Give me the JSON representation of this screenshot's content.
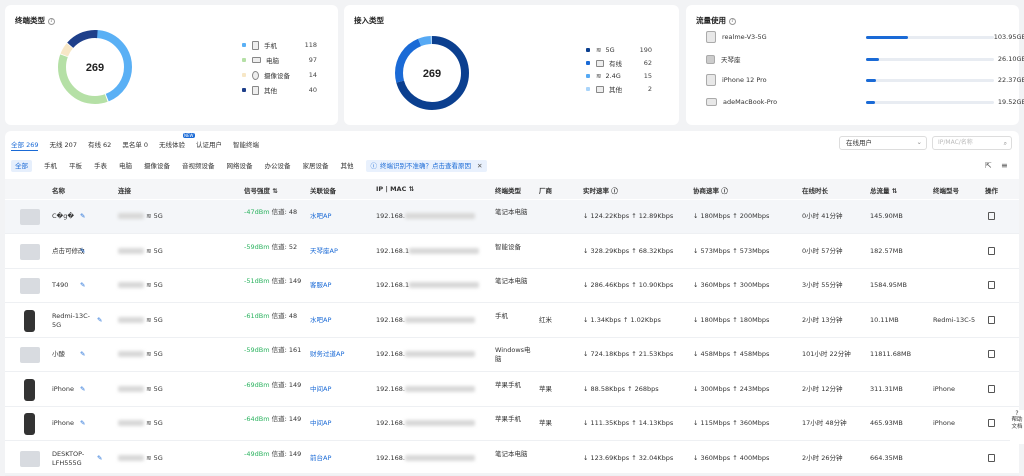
{
  "terminal_type": {
    "title": "终端类型",
    "total": "269",
    "items": [
      {
        "label": "手机",
        "value": "118",
        "color": "#5ab0f5"
      },
      {
        "label": "电脑",
        "value": "97",
        "color": "#b5e0a6"
      },
      {
        "label": "摄像设备",
        "value": "14",
        "color": "#f7e7c6"
      },
      {
        "label": "其他",
        "value": "40",
        "color": "#1e3f8a"
      }
    ]
  },
  "access_type": {
    "title": "接入类型",
    "total": "269",
    "items": [
      {
        "label": "5G",
        "value": "190",
        "color": "#0b3f8f"
      },
      {
        "label": "有线",
        "value": "62",
        "color": "#1a6ad6"
      },
      {
        "label": "2.4G",
        "value": "15",
        "color": "#56a9f4"
      },
      {
        "label": "其他",
        "value": "2",
        "color": "#a9d4fa"
      }
    ]
  },
  "traffic": {
    "title": "流量使用",
    "items": [
      {
        "label": "realme-V3-5G",
        "value": "103.95GB",
        "ratio": 0.33
      },
      {
        "label": "天琴座",
        "value": "26.10GB",
        "ratio": 0.1
      },
      {
        "label": "iPhone 12 Pro",
        "value": "22.37GB",
        "ratio": 0.08
      },
      {
        "label": "adeMacBook-Pro",
        "value": "19.52GB",
        "ratio": 0.07
      }
    ]
  },
  "tabs": [
    {
      "label": "全部 269",
      "active": true
    },
    {
      "label": "无线 207"
    },
    {
      "label": "有线 62"
    },
    {
      "label": "黑名单 0"
    },
    {
      "label": "无线体验",
      "badge": "NEW"
    },
    {
      "label": "认证用户"
    },
    {
      "label": "智能终端"
    }
  ],
  "filter": {
    "select": "在线用户",
    "search_placeholder": "IP/MAC/名称"
  },
  "chips": [
    "全部",
    "手机",
    "平板",
    "手表",
    "电脑",
    "摄像设备",
    "音视频设备",
    "网络设备",
    "办公设备",
    "家居设备",
    "其他"
  ],
  "notice": "终端识别不准确？点击查看原因",
  "columns": [
    "名称",
    "连接",
    "信号强度",
    "关联设备",
    "IP | MAC",
    "终端类型",
    "厂商",
    "实时速率",
    "协商速率",
    "在线时长",
    "总流量",
    "终端型号",
    "操作"
  ],
  "rows": [
    {
      "name": "C�g�",
      "band": "5G",
      "signal": "-47dBm",
      "channel": "信道: 48",
      "ap": "水吧AP",
      "ip": "192.168.",
      "type": "笔记本电脑",
      "vendor": "",
      "rt": "↓ 124.22Kbps ↑ 12.89Kbps",
      "neg": "↓ 180Mbps ↑ 200Mbps",
      "dur": "0小时 41分钟",
      "total": "145.90MB",
      "model": "",
      "thumb": "laptop"
    },
    {
      "name": "点击可修改",
      "band": "5G",
      "signal": "-59dBm",
      "channel": "信道: 52",
      "ap": "天琴座AP",
      "ip": "192.168.1",
      "type": "智能设备",
      "vendor": "",
      "rt": "↓ 328.29Kbps ↑ 68.32Kbps",
      "neg": "↓ 573Mbps ↑ 573Mbps",
      "dur": "0小时 57分钟",
      "total": "182.57MB",
      "model": "",
      "thumb": "house"
    },
    {
      "name": "T490",
      "band": "5G",
      "signal": "-51dBm",
      "channel": "信道: 149",
      "ap": "客服AP",
      "ip": "192.168.1",
      "type": "笔记本电脑",
      "vendor": "",
      "rt": "↓ 286.46Kbps ↑ 10.90Kbps",
      "neg": "↓ 360Mbps ↑ 300Mbps",
      "dur": "3小时 55分钟",
      "total": "1584.95MB",
      "model": "",
      "thumb": "laptop"
    },
    {
      "name": "Redmi-13C-5G",
      "band": "5G",
      "signal": "-61dBm",
      "channel": "信道: 48",
      "ap": "水吧AP",
      "ip": "192.168.",
      "type": "手机",
      "vendor": "红米",
      "rt": "↓ 1.34Kbps ↑ 1.02Kbps",
      "neg": "↓ 180Mbps ↑ 180Mbps",
      "dur": "2小时 13分钟",
      "total": "10.11MB",
      "model": "Redmi-13C-5",
      "thumb": "phone"
    },
    {
      "name": "小酸",
      "band": "5G",
      "signal": "-59dBm",
      "channel": "信道: 161",
      "ap": "财务过道AP",
      "ip": "192.168.",
      "type": "Windows电脑",
      "vendor": "",
      "rt": "↓ 724.18Kbps ↑ 21.53Kbps",
      "neg": "↓ 458Mbps ↑ 458Mbps",
      "dur": "101小时 22分钟",
      "total": "11811.68MB",
      "model": "",
      "thumb": "laptop"
    },
    {
      "name": "iPhone",
      "band": "5G",
      "signal": "-69dBm",
      "channel": "信道: 149",
      "ap": "中间AP",
      "ip": "192.168.",
      "type": "苹果手机",
      "vendor": "苹果",
      "rt": "↓ 88.58Kbps ↑ 268bps",
      "neg": "↓ 300Mbps ↑ 243Mbps",
      "dur": "2小时 12分钟",
      "total": "311.31MB",
      "model": "iPhone",
      "thumb": "phone"
    },
    {
      "name": "iPhone",
      "band": "5G",
      "signal": "-64dBm",
      "channel": "信道: 149",
      "ap": "中间AP",
      "ip": "192.168.",
      "type": "苹果手机",
      "vendor": "苹果",
      "rt": "↓ 111.35Kbps ↑ 14.13Kbps",
      "neg": "↓ 115Mbps ↑ 360Mbps",
      "dur": "17小时 48分钟",
      "total": "465.93MB",
      "model": "iPhone",
      "thumb": "phone"
    },
    {
      "name": "DESKTOP-LFH555G",
      "band": "5G",
      "signal": "-49dBm",
      "channel": "信道: 149",
      "ap": "前台AP",
      "ip": "192.168.",
      "type": "笔记本电脑",
      "vendor": "",
      "rt": "↓ 123.69Kbps ↑ 32.04Kbps",
      "neg": "↓ 360Mbps ↑ 400Mbps",
      "dur": "2小时 26分钟",
      "total": "664.35MB",
      "model": "",
      "thumb": "laptop"
    }
  ],
  "help": "帮助文档"
}
